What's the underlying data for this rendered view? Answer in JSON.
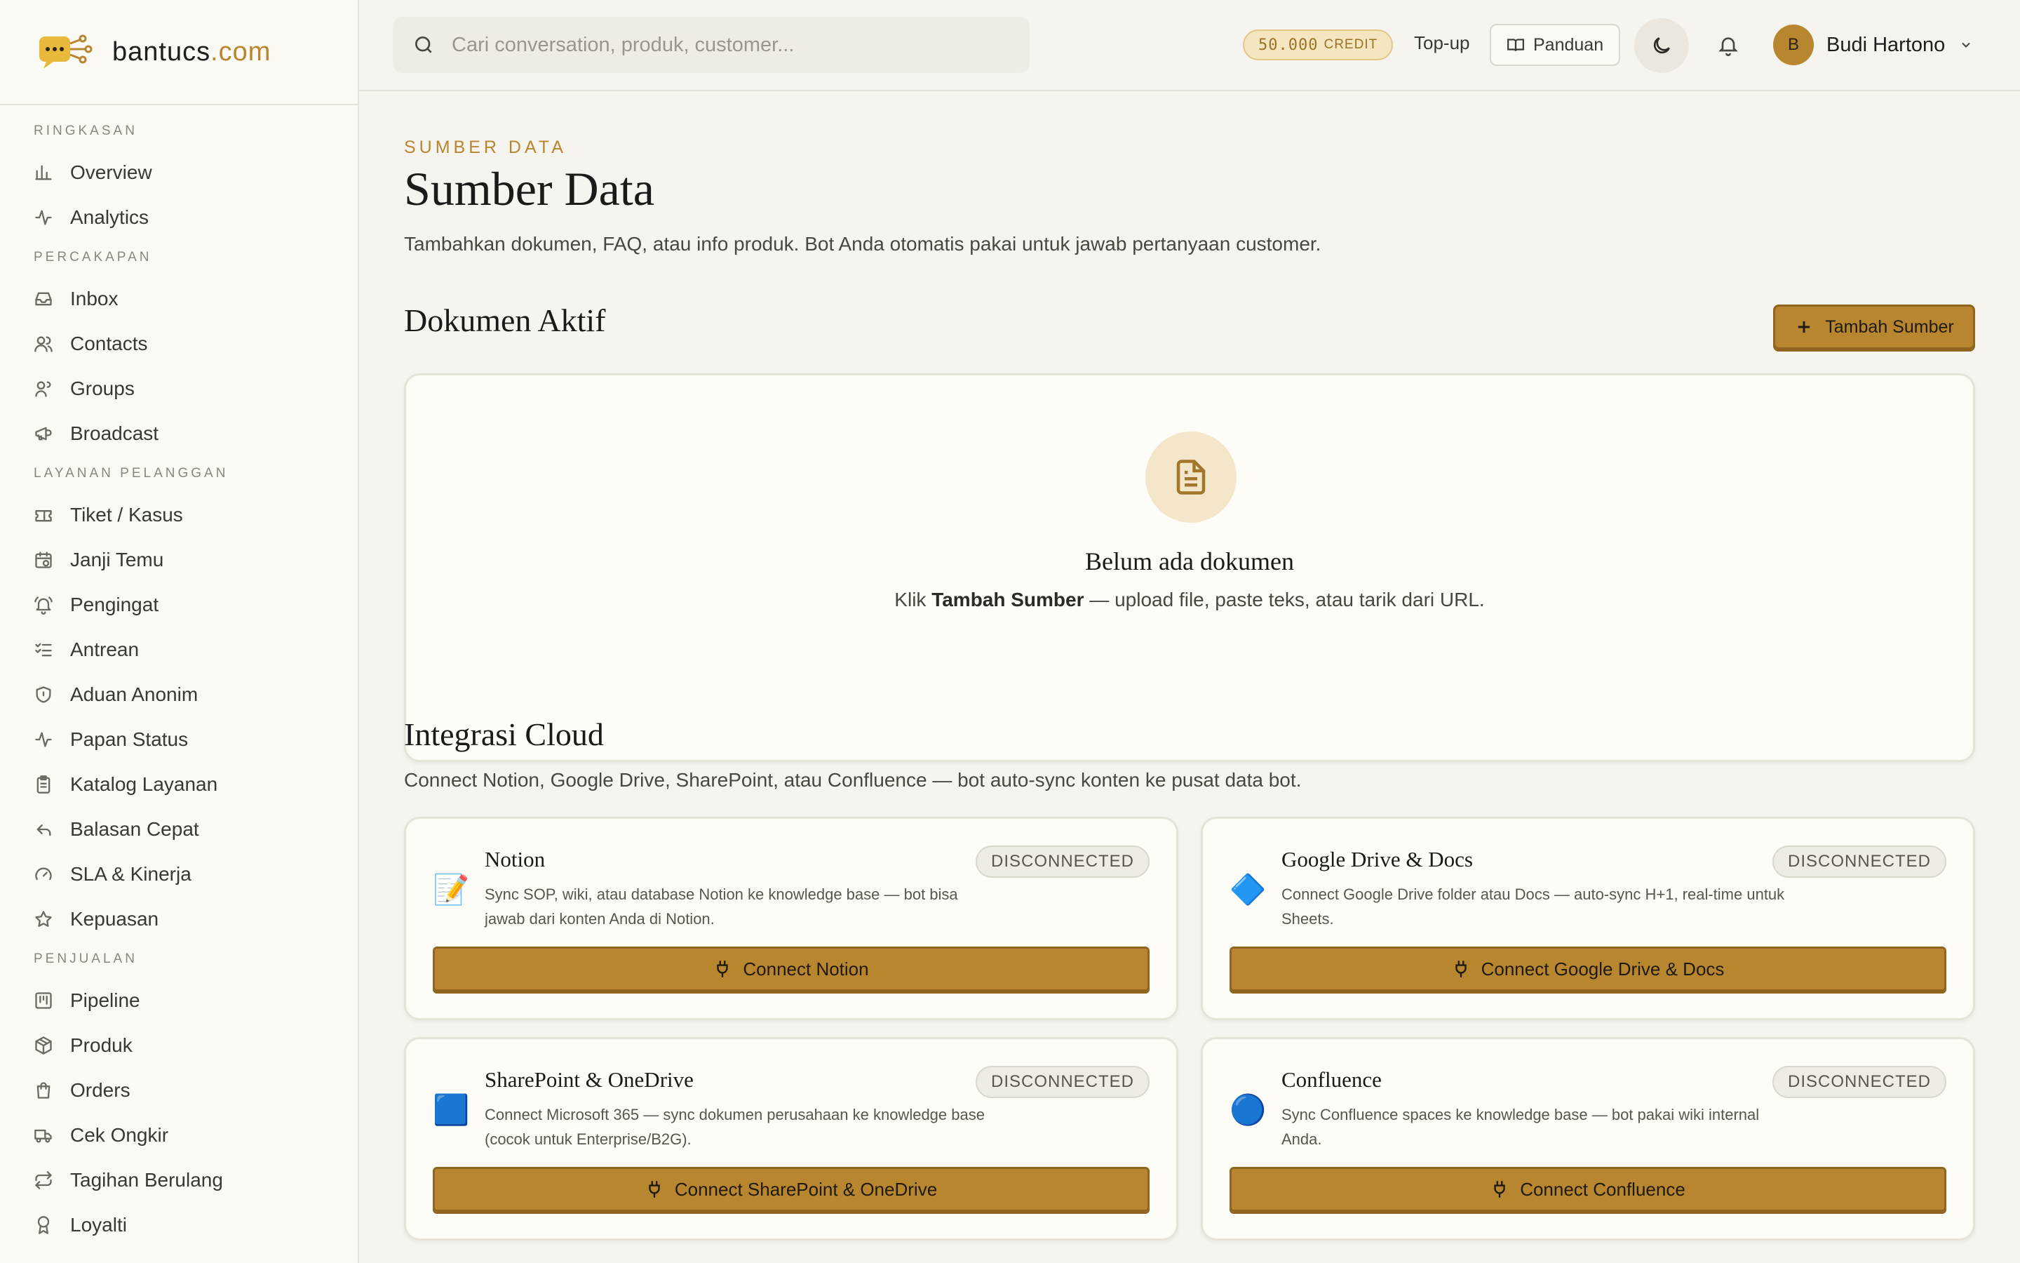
{
  "brand": {
    "name": "bantucs",
    "tld": ".com"
  },
  "sidebar": {
    "sections": [
      {
        "label": "RINGKASAN",
        "items": [
          {
            "label": "Overview",
            "icon": "bar-chart-icon"
          },
          {
            "label": "Analytics",
            "icon": "activity-icon"
          }
        ]
      },
      {
        "label": "PERCAKAPAN",
        "items": [
          {
            "label": "Inbox",
            "icon": "inbox-icon"
          },
          {
            "label": "Contacts",
            "icon": "users-icon"
          },
          {
            "label": "Groups",
            "icon": "user-group-icon"
          },
          {
            "label": "Broadcast",
            "icon": "megaphone-icon"
          }
        ]
      },
      {
        "label": "LAYANAN PELANGGAN",
        "items": [
          {
            "label": "Tiket / Kasus",
            "icon": "ticket-icon"
          },
          {
            "label": "Janji Temu",
            "icon": "calendar-clock-icon"
          },
          {
            "label": "Pengingat",
            "icon": "bell-ring-icon"
          },
          {
            "label": "Antrean",
            "icon": "list-checks-icon"
          },
          {
            "label": "Aduan Anonim",
            "icon": "shield-icon"
          },
          {
            "label": "Papan Status",
            "icon": "activity-icon"
          },
          {
            "label": "Katalog Layanan",
            "icon": "clipboard-icon"
          },
          {
            "label": "Balasan Cepat",
            "icon": "reply-icon"
          },
          {
            "label": "SLA & Kinerja",
            "icon": "gauge-icon"
          },
          {
            "label": "Kepuasan",
            "icon": "star-icon"
          }
        ]
      },
      {
        "label": "PENJUALAN",
        "items": [
          {
            "label": "Pipeline",
            "icon": "kanban-icon"
          },
          {
            "label": "Produk",
            "icon": "package-icon"
          },
          {
            "label": "Orders",
            "icon": "shopping-bag-icon"
          },
          {
            "label": "Cek Ongkir",
            "icon": "truck-icon"
          },
          {
            "label": "Tagihan Berulang",
            "icon": "repeat-icon"
          },
          {
            "label": "Loyalti",
            "icon": "award-icon"
          }
        ]
      }
    ]
  },
  "topbar": {
    "search_placeholder": "Cari conversation, produk, customer...",
    "credit_amount": "50.000",
    "credit_label": "CREDIT",
    "topup_label": "Top-up",
    "guide_label": "Panduan",
    "user_initial": "B",
    "user_name": "Budi Hartono"
  },
  "page": {
    "eyebrow": "SUMBER DATA",
    "title": "Sumber Data",
    "description": "Tambahkan dokumen, FAQ, atau info produk. Bot Anda otomatis pakai untuk jawab pertanyaan customer.",
    "active_docs_title": "Dokumen Aktif",
    "add_source_label": "Tambah Sumber",
    "empty_title": "Belum ada dokumen",
    "empty_prefix": "Klik",
    "empty_strong": "Tambah Sumber",
    "empty_suffix": "— upload file, paste teks, atau tarik dari URL.",
    "cloud_title": "Integrasi Cloud",
    "cloud_description": "Connect Notion, Google Drive, SharePoint, atau Confluence — bot auto-sync konten ke pusat data bot."
  },
  "integrations": [
    {
      "name": "Notion",
      "emoji": "📝",
      "status": "DISCONNECTED",
      "description": "Sync SOP, wiki, atau database Notion ke knowledge base — bot bisa jawab dari konten Anda di Notion.",
      "button": "Connect Notion"
    },
    {
      "name": "Google Drive & Docs",
      "emoji": "🔷",
      "status": "DISCONNECTED",
      "description": "Connect Google Drive folder atau Docs — auto-sync H+1, real-time untuk Sheets.",
      "button": "Connect Google Drive & Docs"
    },
    {
      "name": "SharePoint & OneDrive",
      "emoji": "🟦",
      "status": "DISCONNECTED",
      "description": "Connect Microsoft 365 — sync dokumen perusahaan ke knowledge base (cocok untuk Enterprise/B2G).",
      "button": "Connect SharePoint & OneDrive"
    },
    {
      "name": "Confluence",
      "emoji": "🔵",
      "status": "DISCONNECTED",
      "description": "Sync Confluence spaces ke knowledge base — bot pakai wiki internal Anda.",
      "button": "Connect Confluence"
    }
  ],
  "colors": {
    "accent": "#b8862f",
    "accent_dark": "#8f6520",
    "background": "#f6f4ef",
    "card": "#fefcf6"
  }
}
